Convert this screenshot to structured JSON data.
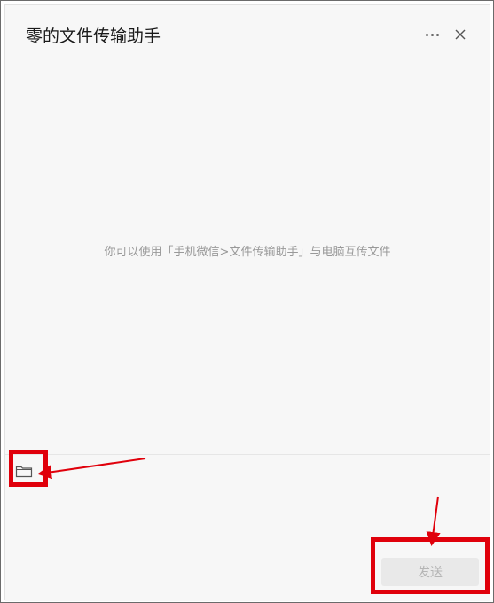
{
  "window": {
    "title": "零的文件传输助手"
  },
  "message_area": {
    "hint": "你可以使用「手机微信>文件传输助手」与电脑互传文件"
  },
  "composer": {
    "send_label": "发送",
    "input_value": ""
  },
  "icons": {
    "more": "more-icon",
    "close": "close-icon",
    "folder": "folder-icon"
  },
  "colors": {
    "annotation": "#e0000b",
    "send_disabled_bg": "#e9e9e9",
    "send_disabled_text": "#b5b5b5"
  }
}
